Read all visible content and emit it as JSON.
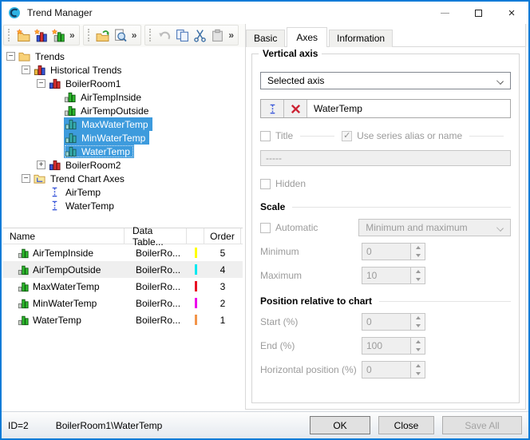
{
  "window": {
    "title": "Trend Manager",
    "controls": {
      "minimize": "minimize",
      "maximize": "maximize",
      "close": "×"
    }
  },
  "toolbar": {
    "overflow_glyph": "»",
    "groups": [
      {
        "icons": [
          "new-folder-icon",
          "new-trend-icon",
          "new-series-icon"
        ]
      },
      {
        "icons": [
          "open-import-icon",
          "print-preview-icon"
        ]
      },
      {
        "icons": [
          "undo-icon",
          "copy-icon",
          "cut-icon",
          "paste-icon"
        ]
      }
    ]
  },
  "tabs": [
    {
      "label": "Basic",
      "active": false
    },
    {
      "label": "Axes",
      "active": true
    },
    {
      "label": "Information",
      "active": false
    }
  ],
  "tree": {
    "items": [
      {
        "label": "Trends",
        "level": 0,
        "expander": "-",
        "icon": "folder-icon",
        "selected": false
      },
      {
        "label": "Historical Trends",
        "level": 1,
        "expander": "-",
        "icon": "chart-multi-icon",
        "selected": false
      },
      {
        "label": "BoilerRoom1",
        "level": 2,
        "expander": "-",
        "icon": "chart-bluered-icon",
        "selected": false
      },
      {
        "label": "AirTempInside",
        "level": 3,
        "expander": "",
        "icon": "chart-green-icon",
        "selected": false
      },
      {
        "label": "AirTempOutside",
        "level": 3,
        "expander": "",
        "icon": "chart-green-icon",
        "selected": false
      },
      {
        "label": "MaxWaterTemp",
        "level": 3,
        "expander": "",
        "icon": "chart-teal-icon",
        "selected": true
      },
      {
        "label": "MinWaterTemp",
        "level": 3,
        "expander": "",
        "icon": "chart-teal-icon",
        "selected": true
      },
      {
        "label": "WaterTemp",
        "level": 3,
        "expander": "",
        "icon": "chart-teal-icon",
        "selected": true,
        "focused": true
      },
      {
        "label": "BoilerRoom2",
        "level": 2,
        "expander": "+",
        "icon": "chart-bluered-icon",
        "selected": false
      },
      {
        "label": "Trend Chart Axes",
        "level": 1,
        "expander": "-",
        "icon": "axes-folder-icon",
        "selected": false
      },
      {
        "label": "AirTemp",
        "level": 2,
        "expander": "",
        "icon": "axis-icon",
        "selected": false
      },
      {
        "label": "WaterTemp",
        "level": 2,
        "expander": "",
        "icon": "axis-icon",
        "selected": false
      }
    ]
  },
  "table": {
    "columns": {
      "name": "Name",
      "data_table": "Data Table...",
      "color": "",
      "order": "Order"
    },
    "rows": [
      {
        "name": "AirTempInside",
        "data_table": "BoilerRo...",
        "color": "#ffff00",
        "order": "5",
        "highlighted": false
      },
      {
        "name": "AirTempOutside",
        "data_table": "BoilerRo...",
        "color": "#00e8f0",
        "order": "4",
        "highlighted": true
      },
      {
        "name": "MaxWaterTemp",
        "data_table": "BoilerRo...",
        "color": "#e81123",
        "order": "3",
        "highlighted": false
      },
      {
        "name": "MinWaterTemp",
        "data_table": "BoilerRo...",
        "color": "#ec00ec",
        "order": "2",
        "highlighted": false
      },
      {
        "name": "WaterTemp",
        "data_table": "BoilerRo...",
        "color": "#f2944a",
        "order": "1",
        "highlighted": false
      }
    ]
  },
  "panel": {
    "group_title": "Vertical axis",
    "axis_selector_value": "Selected axis",
    "axis_name": "WaterTemp",
    "axis_buttons": [
      "axis-icon",
      "delete-x-icon"
    ],
    "title_checkbox_label": "Title",
    "title_checked": false,
    "use_alias_label": "Use series alias or name",
    "use_alias_checked": true,
    "title_value": "-----",
    "hidden_checkbox_label": "Hidden",
    "hidden_checked": false,
    "scale": {
      "header": "Scale",
      "automatic_label": "Automatic",
      "automatic_checked": false,
      "mode_value": "Minimum and maximum",
      "minimum_label": "Minimum",
      "minimum_value": "0",
      "maximum_label": "Maximum",
      "maximum_value": "10"
    },
    "position": {
      "header": "Position relative to chart",
      "start_label": "Start (%)",
      "start_value": "0",
      "end_label": "End (%)",
      "end_value": "100",
      "horizontal_label": "Horizontal position (%)",
      "horizontal_value": "0"
    }
  },
  "buttons": {
    "ok": "OK",
    "close": "Close",
    "save_all": "Save All"
  },
  "statusbar": {
    "id": "ID=2",
    "path": "BoilerRoom1\\WaterTemp"
  },
  "colors": {
    "window_border": "#0b7bd7",
    "selection": "#3d9bdd",
    "disabled_text": "#9b9b9b"
  }
}
